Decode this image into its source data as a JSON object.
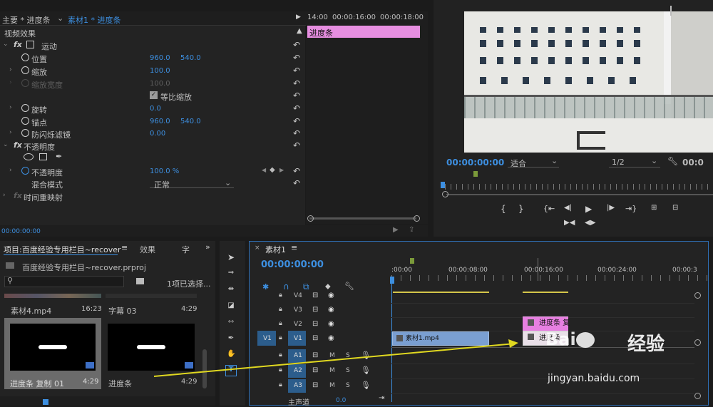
{
  "effect_controls": {
    "tab_main": "主要 * 进度条",
    "tab_source": "素材1 * 进度条",
    "section_video": "视频效果",
    "motion": "运动",
    "position_label": "位置",
    "position_x": "960.0",
    "position_y": "540.0",
    "scale_label": "缩放",
    "scale_val": "100.0",
    "scale_width_label": "缩放宽度",
    "scale_width_val": "100.0",
    "uniform_label": "等比缩放",
    "rotation_label": "旋转",
    "rotation_val": "0.0",
    "anchor_label": "锚点",
    "anchor_x": "960.0",
    "anchor_y": "540.0",
    "flicker_label": "防闪烁滤镜",
    "flicker_val": "0.00",
    "opacity_section": "不透明度",
    "opacity_label": "不透明度",
    "opacity_val": "100.0 %",
    "blend_label": "混合模式",
    "blend_val": "正常",
    "time_remap": "时间重映射",
    "timecode": "00:00:00:00",
    "ruler": [
      "14:00",
      "00:00:16:00",
      "00:00:18:00"
    ],
    "clip_label": "进度条"
  },
  "program": {
    "timecode": "00:00:00:00",
    "fit": "适合",
    "quality": "1/2",
    "timecode_right": "00:0"
  },
  "project": {
    "tab_project": "项目:百度经验专用栏目~recover",
    "tab_effects": "效果",
    "tab_more": "字",
    "file": "百度经验专用栏目~recover.prproj",
    "selected": "1项已选择...",
    "items": [
      {
        "name": "素材4.mp4",
        "dur": "16:23"
      },
      {
        "name": "字幕 03",
        "dur": "4:29"
      },
      {
        "name": "进度条 复制 01",
        "dur": "4:29"
      },
      {
        "name": "进度条",
        "dur": "4:29"
      }
    ]
  },
  "timeline": {
    "tab": "素材1",
    "timecode": "00:00:00:00",
    "ruler": [
      ":00:00",
      "00:00:08:00",
      "00:00:16:00",
      "00:00:24:00",
      "00:00:3"
    ],
    "tracks_v": [
      "V4",
      "V3",
      "V2",
      "V1"
    ],
    "tracks_a": [
      "A1",
      "A2",
      "A3"
    ],
    "src_v": "V1",
    "mute": "M",
    "solo": "S",
    "master": "主声道",
    "master_val": "0.0",
    "clip_main": "素材1.mp4",
    "clip_copy": "进度条 复",
    "clip_bar": "进度条"
  },
  "watermark": {
    "line1": "经验",
    "line2": "jingyan.baidu.com"
  }
}
